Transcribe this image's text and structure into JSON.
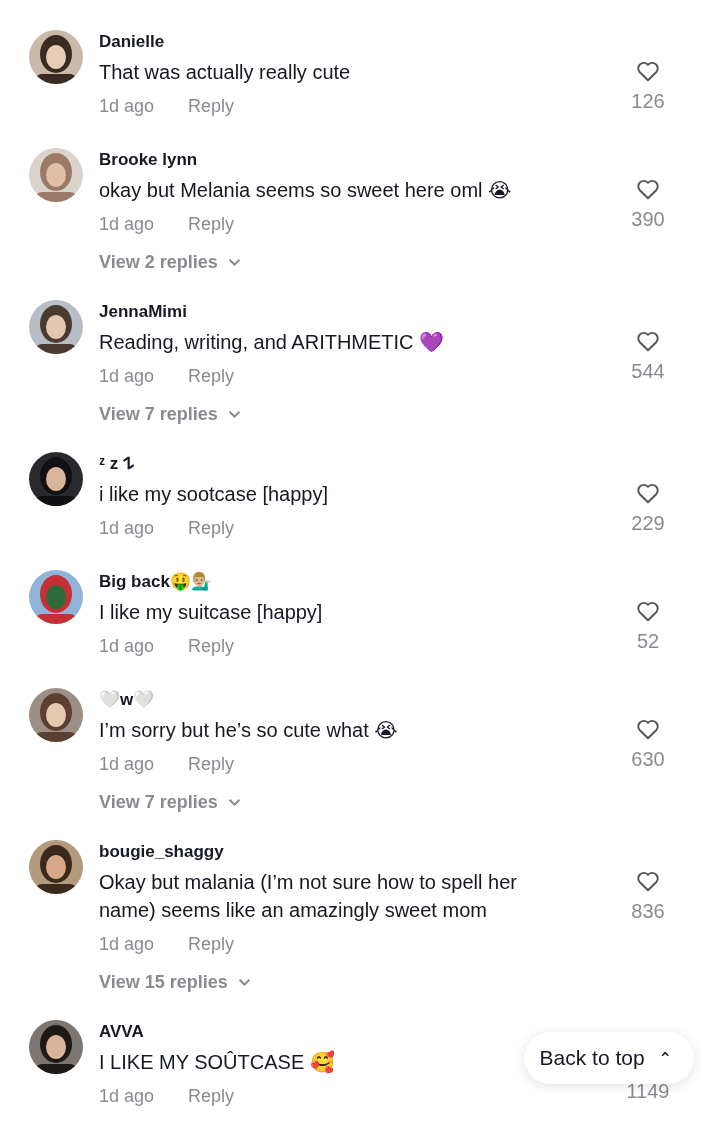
{
  "comments": [
    {
      "name": "Danielle",
      "text": "That was actually really cute",
      "time": "1d ago",
      "reply": "Reply",
      "likes": "126"
    },
    {
      "name": "Brooke lynn",
      "text": "okay but Melania seems so sweet here oml 😭",
      "time": "1d ago",
      "reply": "Reply",
      "likes": "390",
      "view_replies": "View 2 replies"
    },
    {
      "name": "JennaMimi",
      "text": "Reading, writing, and ARITHMETIC 💜",
      "time": "1d ago",
      "reply": "Reply",
      "likes": "544",
      "view_replies": "View 7 replies"
    },
    {
      "name": "ᶻ z 𐰁",
      "text": "i like my sootcase [happy]",
      "time": "1d ago",
      "reply": "Reply",
      "likes": "229"
    },
    {
      "name": "Big back🤑💁🏼‍♂️",
      "text": "I like my suitcase [happy]",
      "time": "1d ago",
      "reply": "Reply",
      "likes": "52"
    },
    {
      "name": "🤍w🤍",
      "text": "I’m sorry but he’s so cute what 😭",
      "time": "1d ago",
      "reply": "Reply",
      "likes": "630",
      "view_replies": "View 7 replies"
    },
    {
      "name": "bougie_shaggy",
      "text": "Okay but malania (I’m not sure how to spell her name) seems like an amazingly sweet mom",
      "time": "1d ago",
      "reply": "Reply",
      "likes": "836",
      "view_replies": "View 15 replies"
    },
    {
      "name": "AVVA",
      "text": "I LIKE MY SOÛTCASE 🥰",
      "time": "1d ago",
      "reply": "Reply",
      "likes": "1149"
    }
  ],
  "back_to_top": {
    "label": "Back to top",
    "icon": "⌃"
  }
}
